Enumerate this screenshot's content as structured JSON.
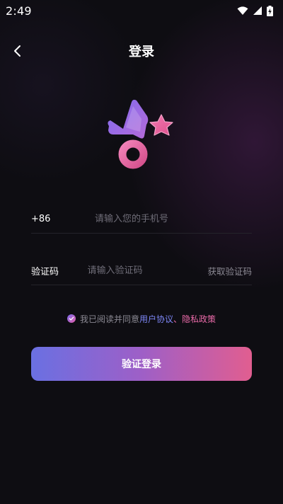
{
  "status_bar": {
    "time": "2:49",
    "icons": [
      "wifi-icon",
      "signal-icon",
      "battery-charging-icon"
    ]
  },
  "header": {
    "title": "登录",
    "back_icon": "back-arrow-icon"
  },
  "phone_field": {
    "country_code": "+86",
    "placeholder": "请输入您的手机号"
  },
  "code_field": {
    "label": "验证码",
    "placeholder": "请输入验证码",
    "get_code_label": "获取验证码"
  },
  "agreement": {
    "prefix": "我已阅读并同意",
    "user_agreement": "用户协议",
    "separator": "、",
    "privacy_policy": "隐私政策",
    "checked": true
  },
  "submit": {
    "label": "验证登录"
  },
  "colors": {
    "background": "#0e0d12",
    "accent_blue": "#7d86f5",
    "accent_pink": "#e96aa8",
    "button_gradient_start": "#6a70e2",
    "button_gradient_end": "#e15e90"
  }
}
